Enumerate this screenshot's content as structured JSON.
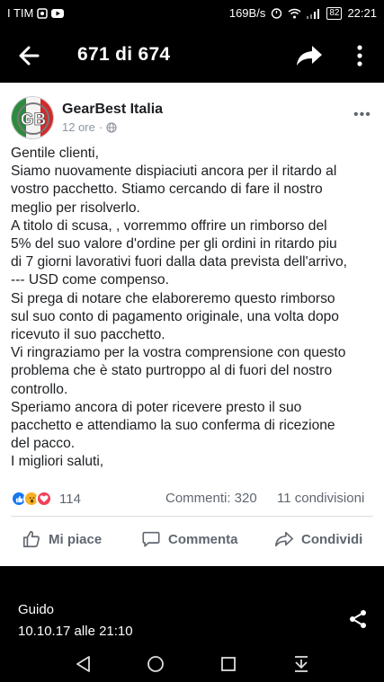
{
  "status": {
    "carrier": "I TIM",
    "net_speed": "169B/s",
    "battery": "82",
    "time": "22:21"
  },
  "header": {
    "counter": "671 di 674",
    "back_icon": "arrow-left-icon",
    "share_icon": "share-arrow-icon",
    "more_icon": "more-vert-icon"
  },
  "post": {
    "author": "GearBest Italia",
    "avatar_text": "GB",
    "time": "12 ore",
    "separator": "·",
    "lines": [
      "Gentile clienti,",
      "Siamo nuovamente dispiaciuti ancora per il ritardo al",
      "vostro pacchetto. Stiamo cercando di fare il nostro",
      "meglio per risolverlo.",
      "A titolo di scusa, , vorremmo offrire un rimborso del",
      "5% del suo valore d'ordine per gli ordini in ritardo piu",
      "di 7 giorni lavorativi fuori dalla data prevista dell'arrivo,",
      "--- USD come compenso.",
      "Si prega di notare che elaboreremo questo rimborso",
      "sul suo conto di pagamento originale, una volta dopo",
      "ricevuto il suo pacchetto.",
      "Vi ringraziamo per la vostra comprensione con questo",
      "problema che è stato purtroppo al di fuori del nostro",
      "controllo.",
      "Speriamo ancora di poter ricevere presto il suo",
      "pacchetto e attendiamo la suo conferma di ricezione",
      "del pacco.",
      "I migliori saluti,"
    ],
    "reaction_count": "114",
    "comments": "Commenti: 320",
    "shares": "11 condivisioni",
    "actions": {
      "like": "Mi piace",
      "comment": "Commenta",
      "share": "Condividi"
    }
  },
  "caption": {
    "name": "Guido",
    "date": "10.10.17 alle 21:10"
  },
  "colors": {
    "facebook_blue": "#1877f2",
    "avatar_green": "#2e8b3e",
    "avatar_red": "#d22b2b"
  }
}
